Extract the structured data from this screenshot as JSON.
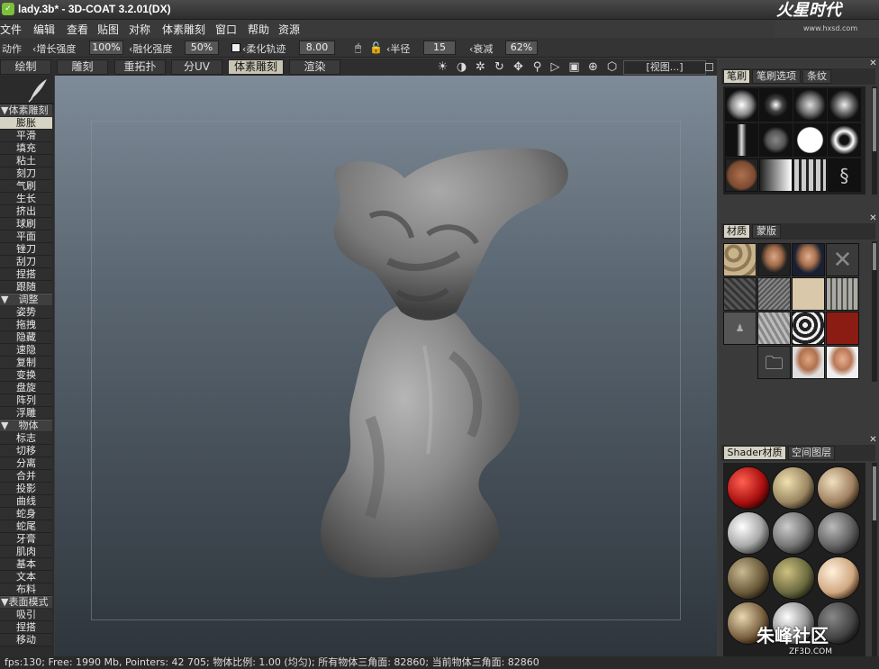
{
  "window": {
    "title": "lady.3b* - 3D-COAT 3.2.01(DX)",
    "app_icon": "app-icon"
  },
  "brand_logo": {
    "text": "火星时代",
    "url_text": "www.hxsd.com"
  },
  "menu": [
    "文件",
    "编辑",
    "查看",
    "贴图",
    "对称",
    "体素雕刻",
    "窗口",
    "帮助",
    "资源"
  ],
  "toolbar": {
    "action_label": "动作",
    "increase_strength_label": "增长强度",
    "increase_strength_value": "100%",
    "smooth_strength_label": "融化强度",
    "smooth_strength_value": "50%",
    "soft_stroke_label": "柔化轨迹",
    "soft_stroke_value": "8.00",
    "radius_label": "半径",
    "radius_value": "15",
    "falloff_label": "衰减",
    "falloff_value": "62%"
  },
  "mode_tabs": [
    "绘制",
    "雕刻",
    "重拓扑",
    "分UV",
    "体素雕刻",
    "渲染"
  ],
  "active_mode_tab": 4,
  "view_dropdown": "[视图...]",
  "tool_sections": [
    {
      "title": "▼体素雕刻",
      "items": [
        "膨胀",
        "平滑",
        "填充",
        "粘土",
        "刻刀",
        "气刷",
        "生长",
        "挤出",
        "球刷",
        "平面",
        "锉刀",
        "刮刀",
        "捏搭",
        "跟随"
      ],
      "active": 0
    },
    {
      "title": "▼　调整",
      "items": [
        "姿势",
        "拖拽",
        "隐藏",
        "速隐",
        "复制",
        "变换",
        "盘旋",
        "阵列",
        "浮雕"
      ]
    },
    {
      "title": "▼　物体",
      "items": [
        "标志",
        "切移",
        "分离",
        "合并",
        "投影",
        "曲线",
        "蛇身",
        "蛇尾",
        "牙膏",
        "肌肉",
        "基本",
        "文本",
        "布料"
      ]
    },
    {
      "title": "▼表面模式",
      "items": [
        "吸引",
        "捏搭",
        "移动"
      ]
    }
  ],
  "brush_panel": {
    "tabs": [
      "笔刷",
      "笔刷选项",
      "条纹"
    ],
    "active": 0
  },
  "material_panel": {
    "tabs": [
      "材质",
      "蒙版"
    ],
    "active": 0
  },
  "shader_panel": {
    "tabs": [
      "Shader材质",
      "空间图层"
    ],
    "active": 0
  },
  "status": "fps:130;    Free: 1990 Mb, Pointers: 42 705; 物体比例: 1.00 (均匀); 所有物体三角面: 82860; 当前物体三角面: 82860",
  "watermark": {
    "text": "朱峰社区",
    "sub": "ZF3D.COM"
  }
}
